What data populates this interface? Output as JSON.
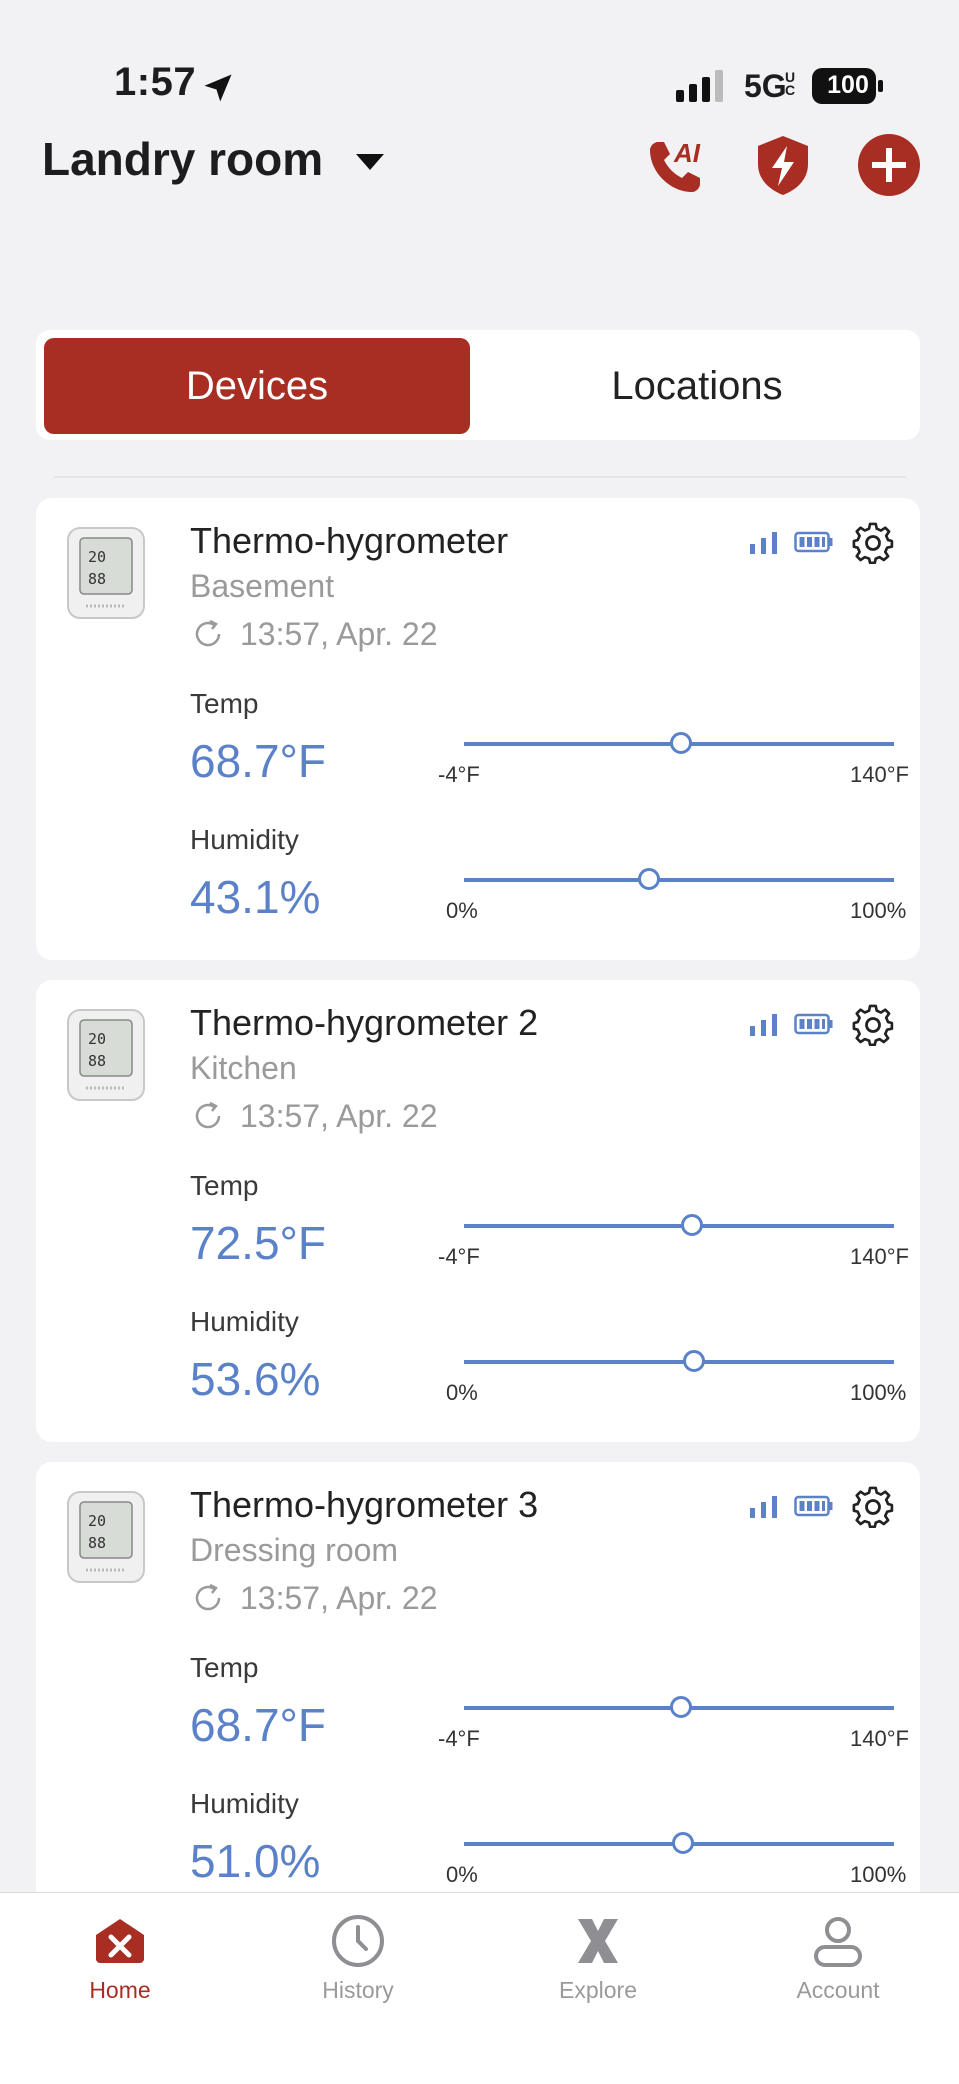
{
  "status_bar": {
    "time": "1:57",
    "network": "5G",
    "network_sub": "UC",
    "battery": "100"
  },
  "header": {
    "location": "Landry room"
  },
  "segment": {
    "devices": "Devices",
    "locations": "Locations"
  },
  "devices": [
    {
      "name": "Thermo-hygrometer",
      "location": "Basement",
      "updated": "13:57, Apr. 22",
      "temp_label": "Temp",
      "temp_value": "68.7°F",
      "temp_min": "-4°F",
      "temp_max": "140°F",
      "temp_fraction": 0.504,
      "hum_label": "Humidity",
      "hum_value": "43.1%",
      "hum_min": "0%",
      "hum_max": "100%",
      "hum_fraction": 0.431
    },
    {
      "name": "Thermo-hygrometer 2",
      "location": "Kitchen",
      "updated": "13:57, Apr. 22",
      "temp_label": "Temp",
      "temp_value": "72.5°F",
      "temp_min": "-4°F",
      "temp_max": "140°F",
      "temp_fraction": 0.531,
      "hum_label": "Humidity",
      "hum_value": "53.6%",
      "hum_min": "0%",
      "hum_max": "100%",
      "hum_fraction": 0.536
    },
    {
      "name": "Thermo-hygrometer 3",
      "location": "Dressing room",
      "updated": "13:57, Apr. 22",
      "temp_label": "Temp",
      "temp_value": "68.7°F",
      "temp_min": "-4°F",
      "temp_max": "140°F",
      "temp_fraction": 0.504,
      "hum_label": "Humidity",
      "hum_value": "51.0%",
      "hum_min": "0%",
      "hum_max": "100%",
      "hum_fraction": 0.51
    }
  ],
  "tabbar": {
    "home": "Home",
    "history": "History",
    "explore": "Explore",
    "account": "Account"
  },
  "colors": {
    "accent": "#a82d23",
    "value_blue": "#5b82c8"
  }
}
